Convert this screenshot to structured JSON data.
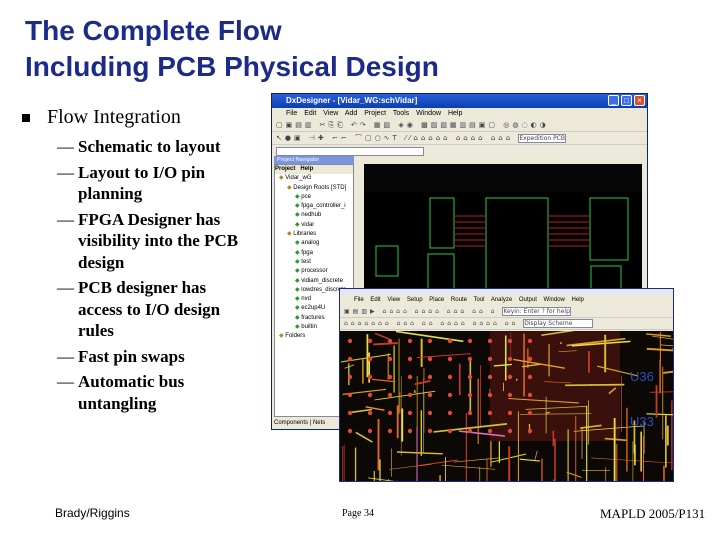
{
  "title": {
    "line1": "The Complete Flow",
    "line2": "Including PCB Physical Design"
  },
  "bullet": {
    "label": "Flow Integration",
    "items": [
      "Schematic to layout",
      "Layout to I/O pin planning",
      "FPGA Designer has visibility into the PCB design",
      "PCB designer has access to I/O design rules",
      "Fast pin swaps",
      "Automatic bus untangling"
    ]
  },
  "footer": {
    "author": "Brady/Riggins",
    "page": "Page 34",
    "conference": "MAPLD 2005/P131"
  },
  "dx": {
    "title": "DxDesigner - [Vidar_WG:schVidar]",
    "menu": "File Edit View Add Project Tools Window Help",
    "combo": "Expedition PCB",
    "panel_title": "Project Navigator",
    "tabs": [
      "Project",
      "Help"
    ],
    "tree": [
      "Vidar_wG",
      "Design Roots [STD]",
      "pce",
      "fpga_controller_i",
      "nedhub",
      "vidar",
      "Libraries",
      "analog",
      "fpga",
      "test",
      "processor",
      "vidiam_discrete",
      "lowdres_discrete",
      "nvd",
      "ec2up4U",
      "fractures",
      "builtin",
      "Folders"
    ],
    "bottom_tabs": [
      "Components",
      "Nets"
    ]
  },
  "pcb": {
    "menu": "File Edit View Setup Place Route Tool Analyze Output Window Help",
    "key_field": "Keyin: Enter ? for help",
    "display": "Display Scheme",
    "labels": [
      "U36",
      "U33"
    ]
  },
  "colors": {
    "title": "#1c2a8a"
  }
}
